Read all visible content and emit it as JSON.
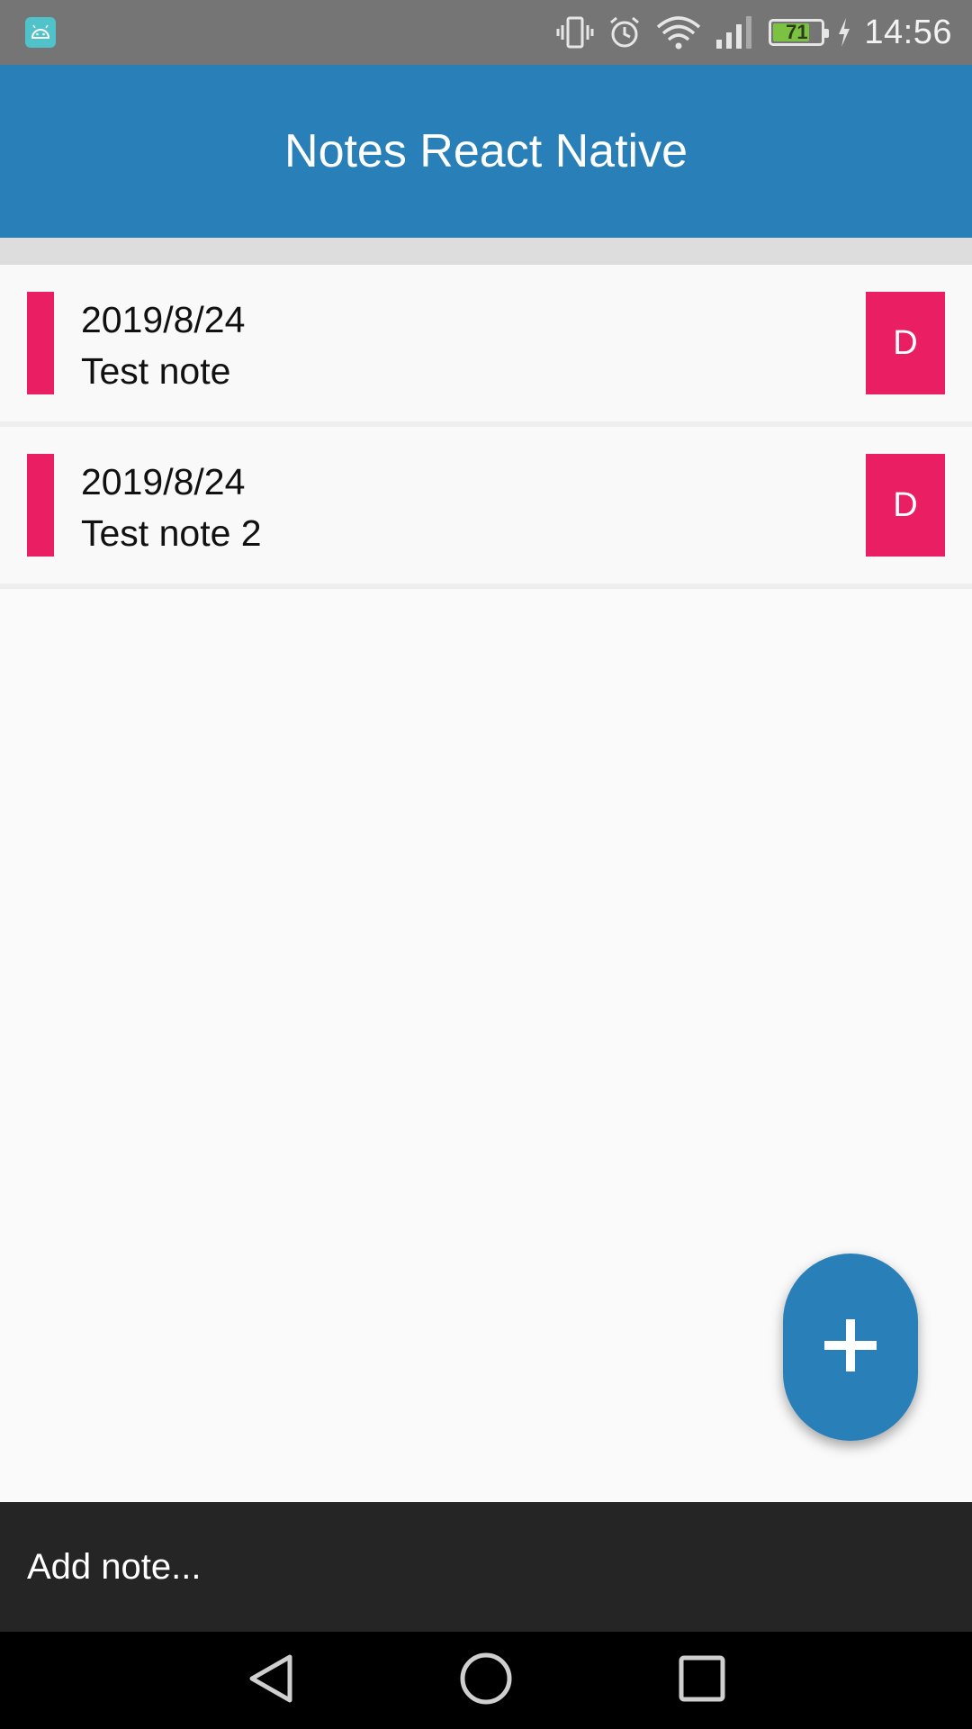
{
  "status_bar": {
    "battery_level": "71",
    "time": "14:56",
    "icons": [
      "android-icon",
      "vibrate-icon",
      "alarm-icon",
      "wifi-icon",
      "signal-icon",
      "battery-icon",
      "charging-icon"
    ]
  },
  "header": {
    "title": "Notes React Native"
  },
  "notes": [
    {
      "date": "2019/8/24",
      "text": "Test note",
      "delete_label": "D"
    },
    {
      "date": "2019/8/24",
      "text": "Test note 2",
      "delete_label": "D"
    }
  ],
  "input": {
    "placeholder": "Add note..."
  },
  "fab": {
    "icon": "plus-icon"
  },
  "colors": {
    "primary": "#2980b9",
    "accent": "#e91e63",
    "input_bar": "#252525",
    "status_bar": "#757575"
  }
}
